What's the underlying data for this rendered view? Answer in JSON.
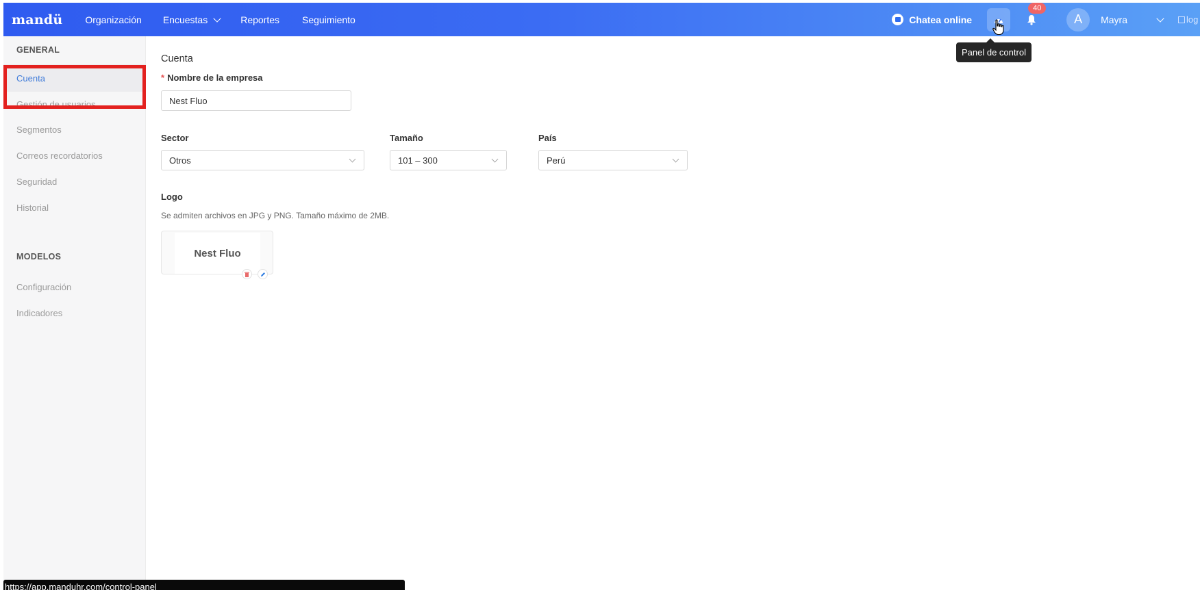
{
  "header": {
    "brand": "mandü",
    "nav": [
      {
        "label": "Organización"
      },
      {
        "label": "Encuestas"
      },
      {
        "label": "Reportes"
      },
      {
        "label": "Seguimiento"
      }
    ],
    "chat_label": "Chatea online",
    "notifications_count": "40",
    "avatar_initial": "A",
    "username": "Mayra",
    "logo_alt": "log"
  },
  "tooltip": {
    "text": "Panel de control"
  },
  "sidebar": {
    "general_heading": "GENERAL",
    "general_items": [
      {
        "label": "Cuenta",
        "active": true
      },
      {
        "label": "Gestión de usuarios"
      },
      {
        "label": "Segmentos"
      },
      {
        "label": "Correos recordatorios"
      },
      {
        "label": "Seguridad"
      },
      {
        "label": "Historial"
      }
    ],
    "models_heading": "MODELOS",
    "models_items": [
      {
        "label": "Configuración"
      },
      {
        "label": "Indicadores"
      }
    ]
  },
  "main": {
    "title": "Cuenta",
    "company_label": "Nombre de la empresa",
    "company_required_mark": "*",
    "company_value": "Nest Fluo",
    "sector_label": "Sector",
    "sector_value": "Otros",
    "size_label": "Tamaño",
    "size_value": "101 – 300",
    "country_label": "País",
    "country_value": "Perú",
    "logo_label": "Logo",
    "logo_hint": "Se admiten archivos en JPG y PNG. Tamaño máximo de 2MB.",
    "logo_preview_text": "Nest Fluo"
  },
  "statusbar": {
    "url": "https://app.manduhr.com/control-panel"
  },
  "colors": {
    "header_start": "#2f5bf0",
    "header_end": "#5aa0f6",
    "active_link": "#3f7bd9",
    "highlight_box": "#e3211f",
    "badge": "#f06565"
  }
}
